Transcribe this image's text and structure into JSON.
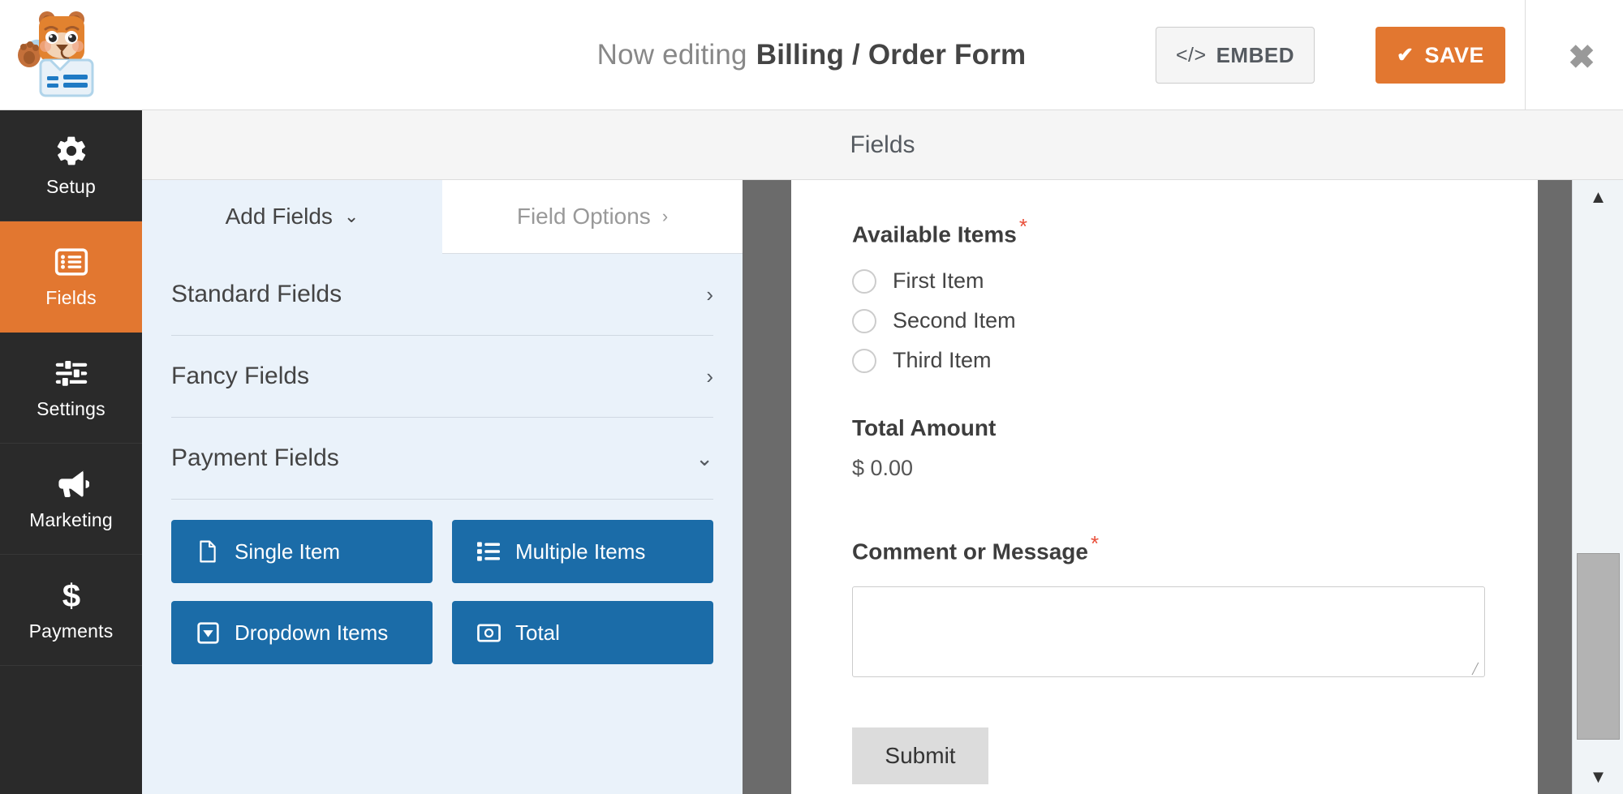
{
  "header": {
    "editing_prefix": "Now editing",
    "form_name": "Billing / Order Form",
    "embed_label": "EMBED",
    "embed_icon": "code-icon",
    "save_label": "SAVE",
    "save_icon": "check-icon",
    "close_icon": "close-icon",
    "logo_icon": "wpforms-mascot-logo",
    "accent_color": "#e27730"
  },
  "sidebar": {
    "items": [
      {
        "label": "Setup",
        "icon": "gear-icon",
        "active": false
      },
      {
        "label": "Fields",
        "icon": "list-icon",
        "active": true
      },
      {
        "label": "Settings",
        "icon": "sliders-icon",
        "active": false
      },
      {
        "label": "Marketing",
        "icon": "megaphone-icon",
        "active": false
      },
      {
        "label": "Payments",
        "icon": "dollar-icon",
        "active": false
      }
    ]
  },
  "panel": {
    "title": "Fields",
    "tabs": [
      {
        "label": "Add Fields",
        "caret": "⌄",
        "active": true
      },
      {
        "label": "Field Options",
        "caret": "›",
        "active": false
      }
    ],
    "accordion": [
      {
        "label": "Standard Fields",
        "arrow": "›",
        "expanded": false
      },
      {
        "label": "Fancy Fields",
        "arrow": "›",
        "expanded": false
      },
      {
        "label": "Payment Fields",
        "arrow": "⌄",
        "expanded": true
      }
    ],
    "field_buttons": [
      {
        "label": "Single Item",
        "icon": "file-icon"
      },
      {
        "label": "Multiple Items",
        "icon": "list-bullet-icon"
      },
      {
        "label": "Dropdown Items",
        "icon": "dropdown-caret-icon"
      },
      {
        "label": "Total",
        "icon": "money-bill-icon"
      }
    ],
    "button_color": "#1b6ca8"
  },
  "preview": {
    "available_items": {
      "label": "Available Items",
      "required_mark": "*",
      "options": [
        "First Item",
        "Second Item",
        "Third Item"
      ]
    },
    "total": {
      "label": "Total Amount",
      "value": "$ 0.00"
    },
    "comment": {
      "label": "Comment or Message",
      "required_mark": "*",
      "value": ""
    },
    "submit_label": "Submit"
  },
  "scrollbar": {
    "up_arrow": "▲",
    "down_arrow": "▼"
  }
}
